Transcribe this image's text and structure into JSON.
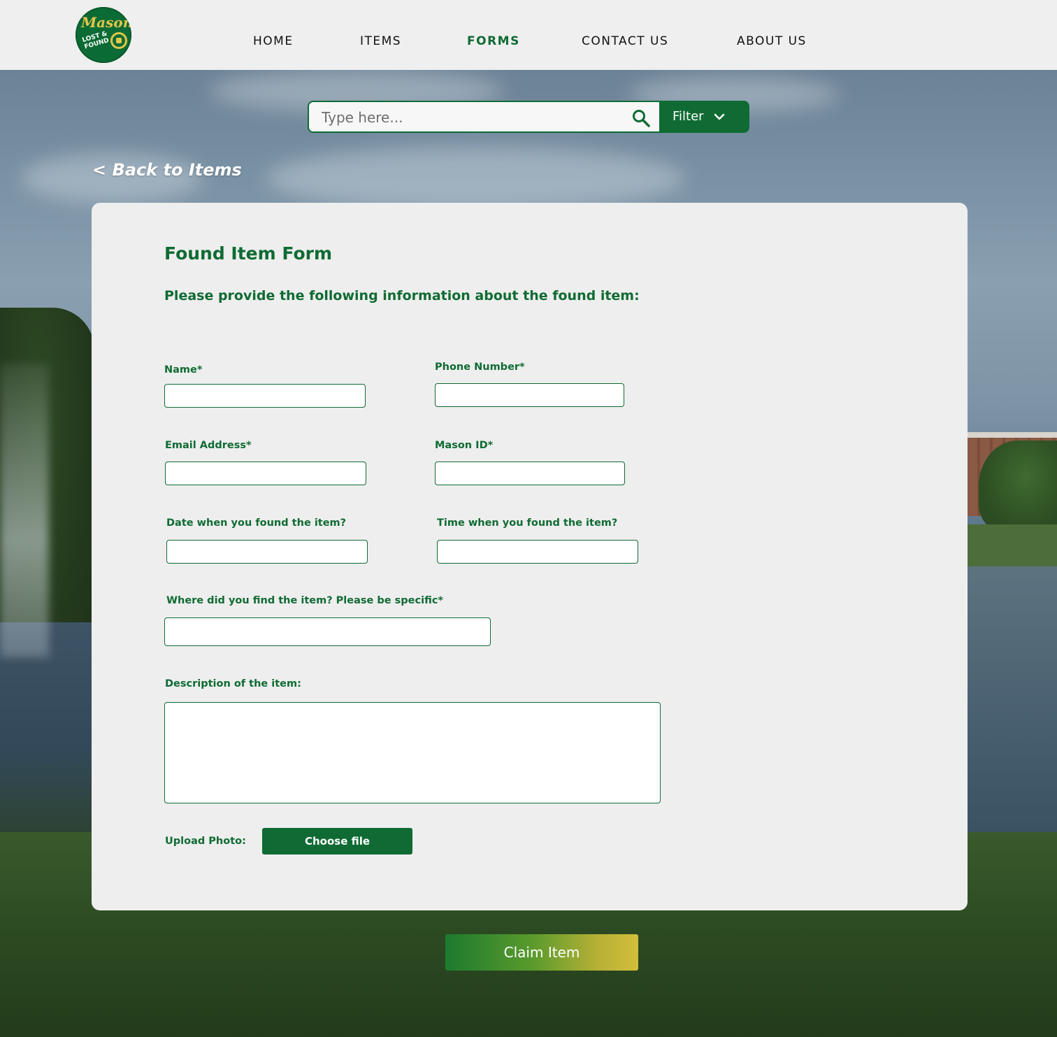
{
  "brand": {
    "logo_text": "Mason",
    "logo_subtext": "LOST & FOUND",
    "accent": "#0f6b33",
    "gold": "#e3c64a"
  },
  "nav": {
    "items": [
      {
        "label": "HOME"
      },
      {
        "label": "ITEMS"
      },
      {
        "label": "FORMS",
        "active": true
      },
      {
        "label": "CONTACT US"
      },
      {
        "label": "ABOUT US"
      }
    ]
  },
  "search": {
    "placeholder": "Type here...",
    "icon": "search-icon",
    "filter_label": "Filter",
    "filter_icon": "chevron-down-icon"
  },
  "back_link": "< Back to Items",
  "form": {
    "title": "Found Item Form",
    "subtitle": "Please provide the following information about the found item:",
    "fields": {
      "name": {
        "label": "Name*",
        "value": ""
      },
      "phone": {
        "label": "Phone Number*",
        "value": ""
      },
      "email": {
        "label": "Email Address*",
        "value": ""
      },
      "mason_id": {
        "label": "Mason ID*",
        "value": ""
      },
      "date_found": {
        "label": "Date when you found the item?",
        "value": ""
      },
      "time_found": {
        "label": "Time when you found the item?",
        "value": ""
      },
      "location": {
        "label": "Where did you find the item? Please be specific*",
        "value": ""
      },
      "description": {
        "label": "Description of the item:",
        "value": ""
      }
    },
    "upload": {
      "label": "Upload Photo:",
      "button": "Choose file"
    }
  },
  "submit_label": "Claim Item"
}
